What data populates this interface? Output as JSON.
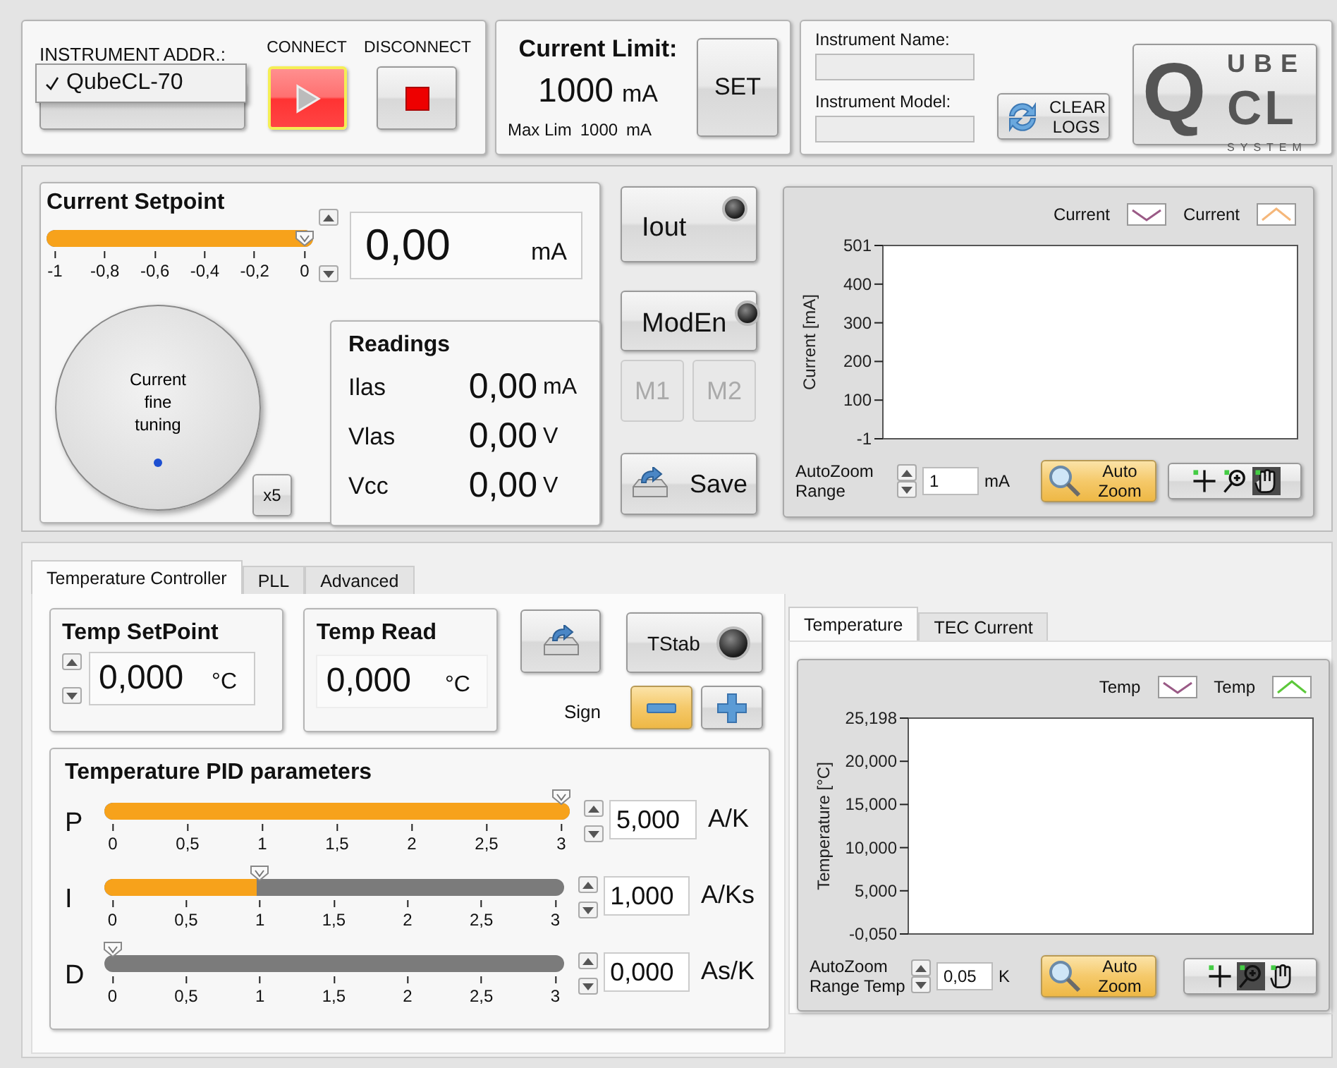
{
  "connection": {
    "address_label": "INSTRUMENT ADDR.:",
    "address_menu": [
      {
        "label": "QubeCL-70",
        "selected": true
      }
    ],
    "connect_label": "CONNECT",
    "disconnect_label": "DISCONNECT"
  },
  "current_limit": {
    "title": "Current Limit:",
    "value": "1000",
    "unit": "mA",
    "max_label": "Max Lim",
    "max_value": "1000",
    "max_unit": "mA",
    "set_button": "SET"
  },
  "instrument": {
    "name_label": "Instrument Name:",
    "model_label": "Instrument Model:",
    "clear_logs_button": "CLEAR LOGS"
  },
  "logo": {
    "letters": [
      "Q",
      "UBE",
      "CL",
      "SYSTEM"
    ]
  },
  "current_setpoint": {
    "title": "Current Setpoint",
    "level": 1,
    "ticks": [
      "-1",
      "-0,8",
      "-0,6",
      "-0,4",
      "-0,2",
      "0"
    ],
    "value": "0,00",
    "unit": "mA",
    "knob_label": "Current fine tuning",
    "multiplier_button": "x5"
  },
  "readings": {
    "title": "Readings",
    "rows": [
      {
        "name": "Ilas",
        "value": "0,00",
        "unit": "mA"
      },
      {
        "name": "Vlas",
        "value": "0,00",
        "unit": "V"
      },
      {
        "name": "Vcc",
        "value": "0,00",
        "unit": "V"
      }
    ]
  },
  "toggles": [
    {
      "label": "Iout",
      "on": false
    },
    {
      "label": "ModEn",
      "on": false
    }
  ],
  "memory_buttons": [
    {
      "label": "M1",
      "disabled": true
    },
    {
      "label": "M2",
      "disabled": true
    }
  ],
  "save_button": "Save",
  "current_chart": {
    "plot": {
      "legend": [
        {
          "label": "Current",
          "color": "#9a5a86"
        },
        {
          "label": "Current",
          "color": "#f5b77a"
        }
      ],
      "y_tick_labels": [
        "501",
        "400",
        "300",
        "200",
        "100",
        "-1"
      ],
      "y_axis_title": "Current [mA]"
    },
    "autozoom_label": "AutoZoom Range",
    "autozoom_value": "1",
    "autozoom_unit": "mA",
    "autozoom_button": "Auto Zoom",
    "tools": [
      {
        "kind": "cursor",
        "selected": false
      },
      {
        "kind": "zoom",
        "selected": false
      },
      {
        "kind": "pan",
        "selected": true
      }
    ]
  },
  "lower_tabs": [
    {
      "label": "Temperature Controller",
      "selected": true
    },
    {
      "label": "PLL",
      "selected": false
    },
    {
      "label": "Advanced",
      "selected": false
    }
  ],
  "temp_setpoint": {
    "title": "Temp SetPoint",
    "value": "0,000",
    "unit": "°C"
  },
  "temp_read": {
    "title": "Temp Read",
    "value": "0,000",
    "unit": "°C"
  },
  "tstab": {
    "label": "TStab",
    "on": false
  },
  "sign": {
    "label": "Sign",
    "options": [
      {
        "kind": "minus",
        "selected": true
      },
      {
        "kind": "plus",
        "selected": false
      }
    ]
  },
  "pid": {
    "title": "Temperature PID parameters",
    "params": [
      {
        "name": "P",
        "level": 1,
        "ticks": [
          "0",
          "0,5",
          "1",
          "1,5",
          "2",
          "2,5",
          "3"
        ],
        "value": "5,000",
        "unit": "A/K"
      },
      {
        "name": "I",
        "level": 0.3333,
        "ticks": [
          "0",
          "0,5",
          "1",
          "1,5",
          "2",
          "2,5",
          "3"
        ],
        "value": "1,000",
        "unit": "A/Ks"
      },
      {
        "name": "D",
        "level": 0,
        "ticks": [
          "0",
          "0,5",
          "1",
          "1,5",
          "2",
          "2,5",
          "3"
        ],
        "value": "0,000",
        "unit": "As/K"
      }
    ]
  },
  "chart_tabs": [
    {
      "label": "Temperature",
      "selected": true
    },
    {
      "label": "TEC Current",
      "selected": false
    }
  ],
  "temp_chart": {
    "plot": {
      "legend": [
        {
          "label": "Temp",
          "color": "#9a5a86"
        },
        {
          "label": "Temp",
          "color": "#5cc83a"
        }
      ],
      "y_tick_labels": [
        "25,198",
        "20,000",
        "15,000",
        "10,000",
        "5,000",
        "-0,050"
      ],
      "y_axis_title": "Temperature [°C]"
    },
    "autozoom_label": "AutoZoom Range Temp",
    "autozoom_value": "0,05",
    "autozoom_unit": "K",
    "autozoom_button": "Auto Zoom",
    "tools": [
      {
        "kind": "cursor",
        "selected": false
      },
      {
        "kind": "zoom",
        "selected": true
      },
      {
        "kind": "pan",
        "selected": false
      }
    ]
  }
}
